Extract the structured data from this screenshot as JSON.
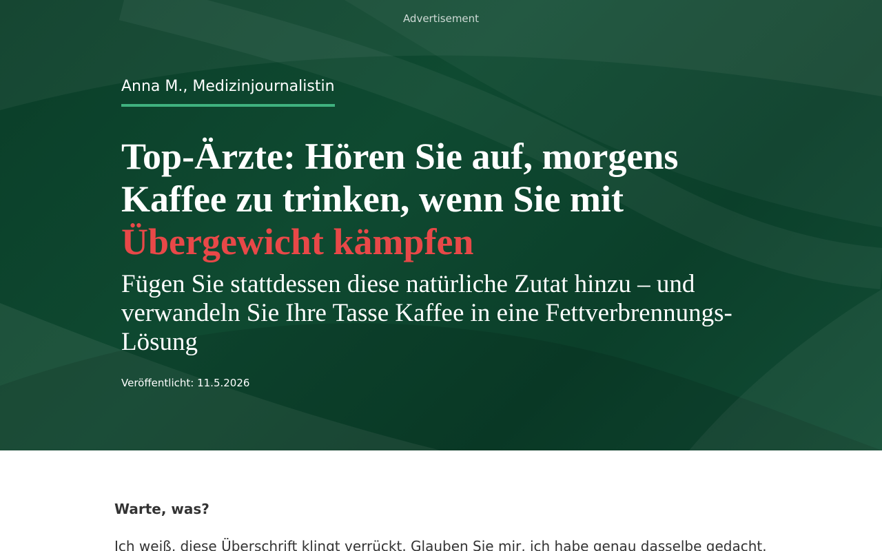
{
  "ad": {
    "label": "Advertisement"
  },
  "hero": {
    "author": "Anna M., Medizinjournalistin",
    "headline_part1": "Top-Ärzte: Hören Sie auf, morgens Kaffee zu trinken, wenn Sie mit ",
    "headline_highlight": "Übergewicht kämpfen",
    "subheadline": "Fügen Sie stattdessen diese natürliche Zutat hinzu – und verwandeln Sie Ihre Tasse Kaffee in eine Fettverbrennungs-Lösung",
    "published": "Veröffentlicht: 11.5.2026"
  },
  "article": {
    "lead_question": "Warte, was?",
    "paragraph_1": "Ich weiß, diese Überschrift klingt verrückt. Glauben Sie mir, ich habe genau dasselbe gedacht."
  },
  "colors": {
    "hero_background": "#0f4a31",
    "accent_underline": "#3fb27f",
    "headline_highlight": "#e84848",
    "body_text": "#333333"
  }
}
